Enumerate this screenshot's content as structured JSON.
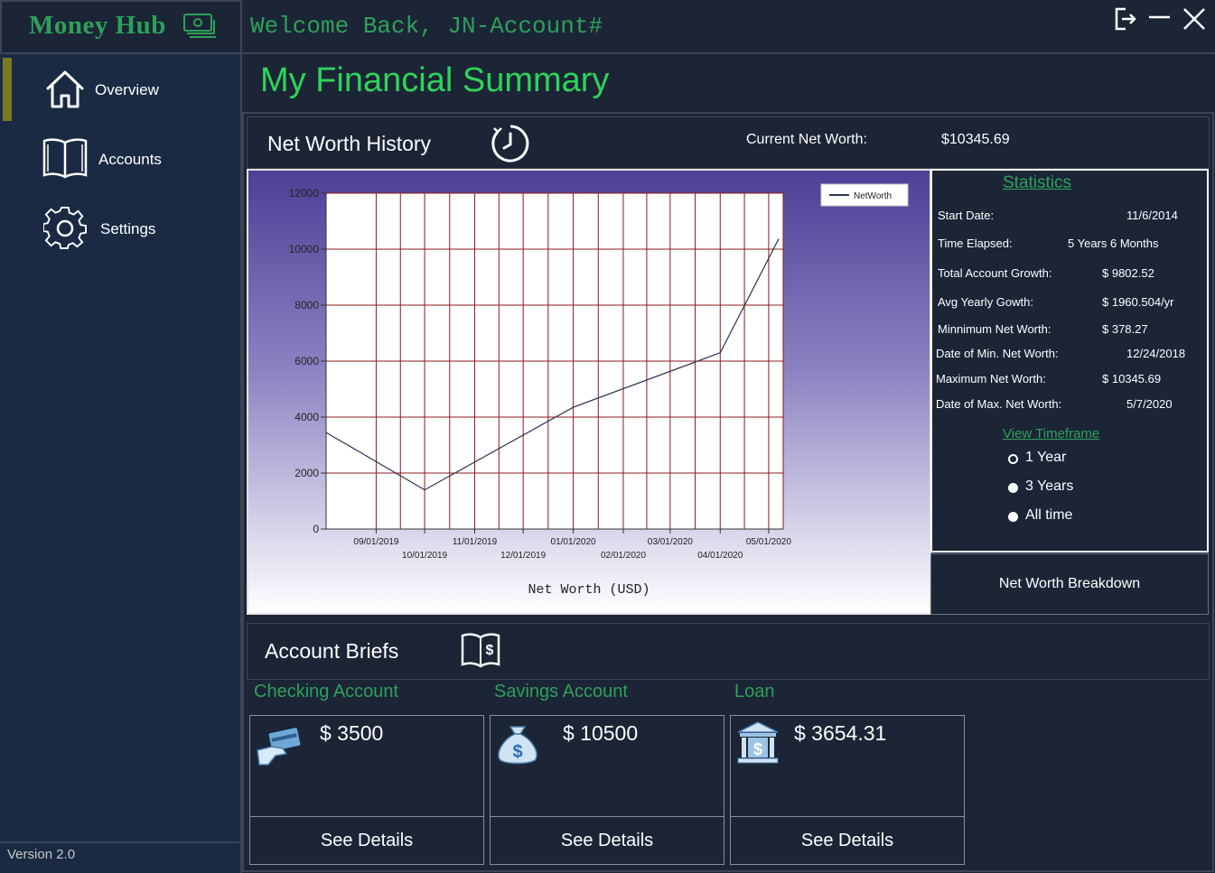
{
  "app": {
    "name": "Money Hub",
    "version": "Version 2.0"
  },
  "sidebar": {
    "items": [
      {
        "label": "Overview",
        "icon": "home-icon",
        "active": true
      },
      {
        "label": "Accounts",
        "icon": "book-icon",
        "active": false
      },
      {
        "label": "Settings",
        "icon": "gear-icon",
        "active": false
      }
    ]
  },
  "header": {
    "welcome": "Welcome Back, JN-Account#"
  },
  "page": {
    "title": "My Financial Summary"
  },
  "net_worth": {
    "title": "Net Worth History",
    "current_label": "Current Net Worth:",
    "current_value": "$10345.69"
  },
  "chart_data": {
    "type": "line",
    "series": [
      {
        "name": "NetWorth",
        "x": [
          "08/01/2019",
          "10/01/2019",
          "01/01/2020",
          "04/01/2020",
          "05/07/2020"
        ],
        "values": [
          3450,
          1400,
          4350,
          6300,
          10345.69
        ]
      }
    ],
    "x_ticks_top": [
      "09/01/2019",
      "11/01/2019",
      "01/01/2020",
      "03/01/2020",
      "05/01/2020"
    ],
    "x_ticks_bottom": [
      "10/01/2019",
      "12/01/2019",
      "02/01/2020",
      "04/01/2020"
    ],
    "y_ticks": [
      "0",
      "2000",
      "4000",
      "6000",
      "8000",
      "10000",
      "12000"
    ],
    "ylim": [
      0,
      12000
    ],
    "xlabel": "Net Worth (USD)",
    "legend": "top-right",
    "grid": true,
    "grid_color": "#8b1a1a",
    "line_color": "#2b3550"
  },
  "statistics": {
    "title": "Statistics",
    "rows": [
      {
        "label": "Start Date:",
        "value": "11/6/2014"
      },
      {
        "label": "Time Elapsed:",
        "value": "5 Years 6 Months"
      },
      {
        "label": "Total Account Growth:",
        "value": "$ 9802.52"
      },
      {
        "label": "Avg Yearly Gowth:",
        "value": "$ 1960.504/yr"
      },
      {
        "label": "Minnimum Net Worth:",
        "value": "$ 378.27"
      },
      {
        "label": "Date of Min. Net Worth:",
        "value": "12/24/2018"
      },
      {
        "label": "Maximum Net Worth:",
        "value": "$ 10345.69"
      },
      {
        "label": "Date of Max. Net Worth:",
        "value": "5/7/2020"
      }
    ],
    "timeframe_title": "View Timeframe",
    "timeframe_options": [
      "1 Year",
      "3 Years",
      "All time"
    ],
    "timeframe_selected": "1 Year",
    "breakdown_button": "Net Worth Breakdown"
  },
  "account_briefs": {
    "title": "Account Briefs",
    "accounts": [
      {
        "name": "Checking Account",
        "amount": "$ 3500",
        "icon": "credit-card-icon",
        "button": "See Details"
      },
      {
        "name": "Savings Account",
        "amount": "$ 10500",
        "icon": "money-bag-icon",
        "button": "See Details"
      },
      {
        "name": "Loan",
        "amount": "$ 3654.31",
        "icon": "bank-icon",
        "button": "See Details"
      }
    ]
  },
  "colors": {
    "accent_green": "#2ea05a",
    "title_green": "#2ed35a",
    "background": "#1b2536",
    "sidebar": "#1a2a43",
    "active_indicator": "#7b7a22"
  }
}
